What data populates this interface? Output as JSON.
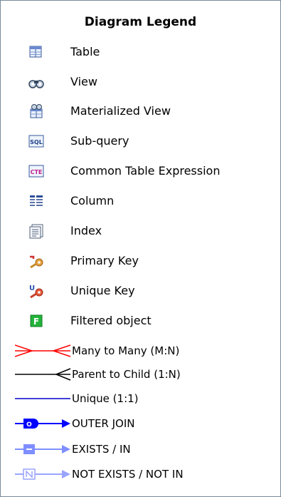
{
  "legend": {
    "title": "Diagram Legend",
    "objects": [
      {
        "label": "Table",
        "icon": "table-icon"
      },
      {
        "label": "View",
        "icon": "view-binoculars-icon"
      },
      {
        "label": "Materialized View",
        "icon": "materialized-view-icon"
      },
      {
        "label": "Sub-query",
        "icon": "sql-subquery-icon"
      },
      {
        "label": "Common Table Expression",
        "icon": "cte-icon"
      },
      {
        "label": "Column",
        "icon": "column-icon"
      },
      {
        "label": "Index",
        "icon": "index-icon"
      },
      {
        "label": "Primary Key",
        "icon": "primary-key-icon"
      },
      {
        "label": "Unique Key",
        "icon": "unique-key-icon"
      },
      {
        "label": "Filtered object",
        "icon": "filter-icon"
      }
    ],
    "relationships": [
      {
        "label": "Many to Many (M:N)",
        "icon": "many-to-many-line-icon",
        "color": "#ff0000"
      },
      {
        "label": "Parent to Child (1:N)",
        "icon": "parent-child-line-icon",
        "color": "#000000"
      },
      {
        "label": "Unique (1:1)",
        "icon": "unique-line-icon",
        "color": "#0000cc"
      },
      {
        "label": "OUTER JOIN",
        "icon": "outer-join-icon",
        "color": "#0000ff"
      },
      {
        "label": "EXISTS / IN",
        "icon": "exists-in-icon",
        "color": "#7f8fff"
      },
      {
        "label": "NOT EXISTS / NOT IN",
        "icon": "not-exists-icon",
        "color": "#9aa4ff"
      }
    ],
    "icon_text": {
      "sql": "SQL",
      "cte": "CTE",
      "filter": "F",
      "outer_join": "O",
      "unique_key": "U"
    }
  }
}
